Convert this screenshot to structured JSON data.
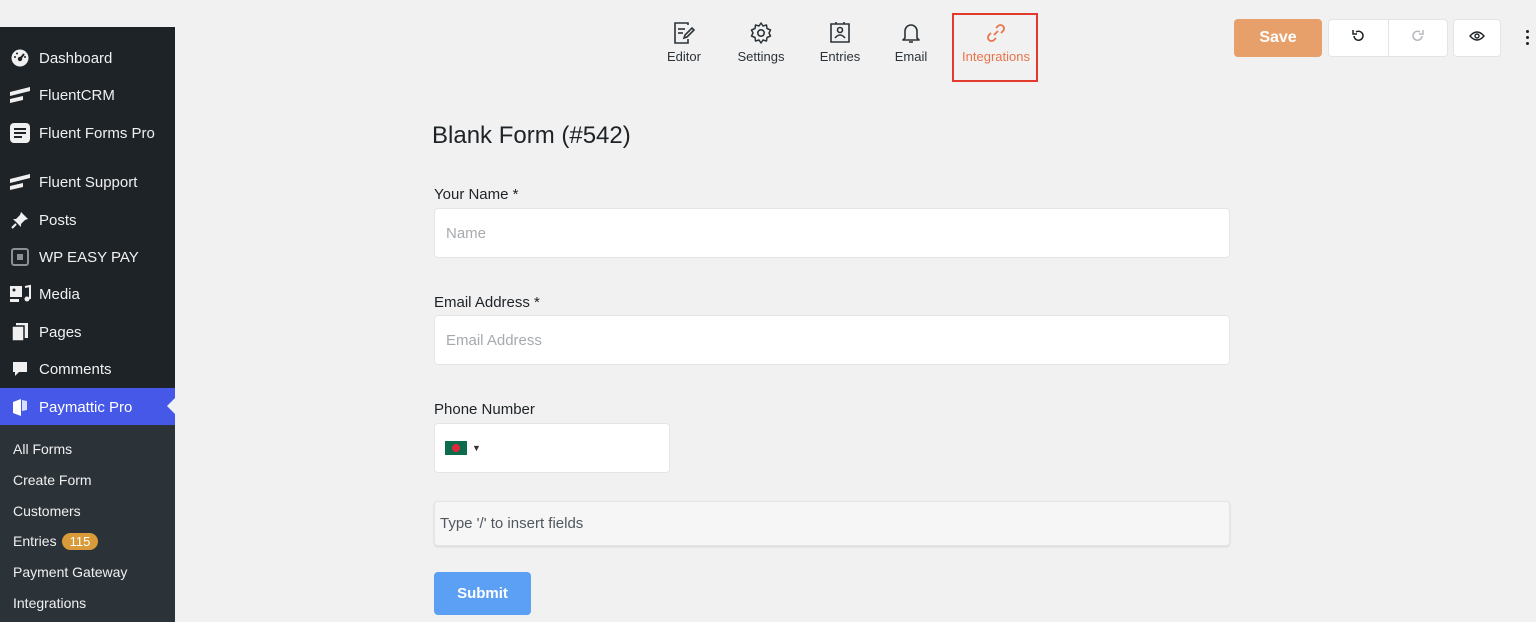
{
  "sidebar": {
    "items": [
      {
        "label": "Dashboard",
        "icon": "dashboard-icon"
      },
      {
        "label": "FluentCRM",
        "icon": "fluentcrm-icon"
      },
      {
        "label": "Fluent Forms Pro",
        "icon": "fluent-forms-icon"
      },
      {
        "label": "Fluent Support",
        "icon": "fluent-support-icon"
      },
      {
        "label": "Posts",
        "icon": "pin-icon"
      },
      {
        "label": "WP EASY PAY",
        "icon": "wp-easy-pay-icon"
      },
      {
        "label": "Media",
        "icon": "media-icon"
      },
      {
        "label": "Pages",
        "icon": "pages-icon"
      },
      {
        "label": "Comments",
        "icon": "comment-icon"
      },
      {
        "label": "Paymattic Pro",
        "icon": "paymattic-icon",
        "active": true
      }
    ],
    "submenu": {
      "all_forms": "All Forms",
      "create_form": "Create Form",
      "customers": "Customers",
      "entries": "Entries",
      "entries_count": "115",
      "payment_gateway": "Payment Gateway",
      "integrations": "Integrations"
    },
    "colors": {
      "background": "#1d2327",
      "active": "#4558e8",
      "badge": "#d99b3a"
    }
  },
  "toolbar": {
    "tabs": [
      {
        "label": "Editor",
        "icon": "editor-icon"
      },
      {
        "label": "Settings",
        "icon": "gear-icon"
      },
      {
        "label": "Entries",
        "icon": "entries-icon"
      },
      {
        "label": "Email",
        "icon": "bell-icon"
      },
      {
        "label": "Integrations",
        "icon": "link-icon",
        "active": true
      }
    ],
    "save_label": "Save",
    "colors": {
      "active": "#e8744a",
      "save": "#e8a06b",
      "highlight": "#e23b2e"
    }
  },
  "form": {
    "title": "Blank Form (#542)",
    "name_label": "Your Name *",
    "name_placeholder": "Name",
    "email_label": "Email Address *",
    "email_placeholder": "Email Address",
    "phone_label": "Phone Number",
    "insert_hint": "Type '/' to insert fields",
    "submit_label": "Submit",
    "submit_color": "#5ba0f5"
  }
}
